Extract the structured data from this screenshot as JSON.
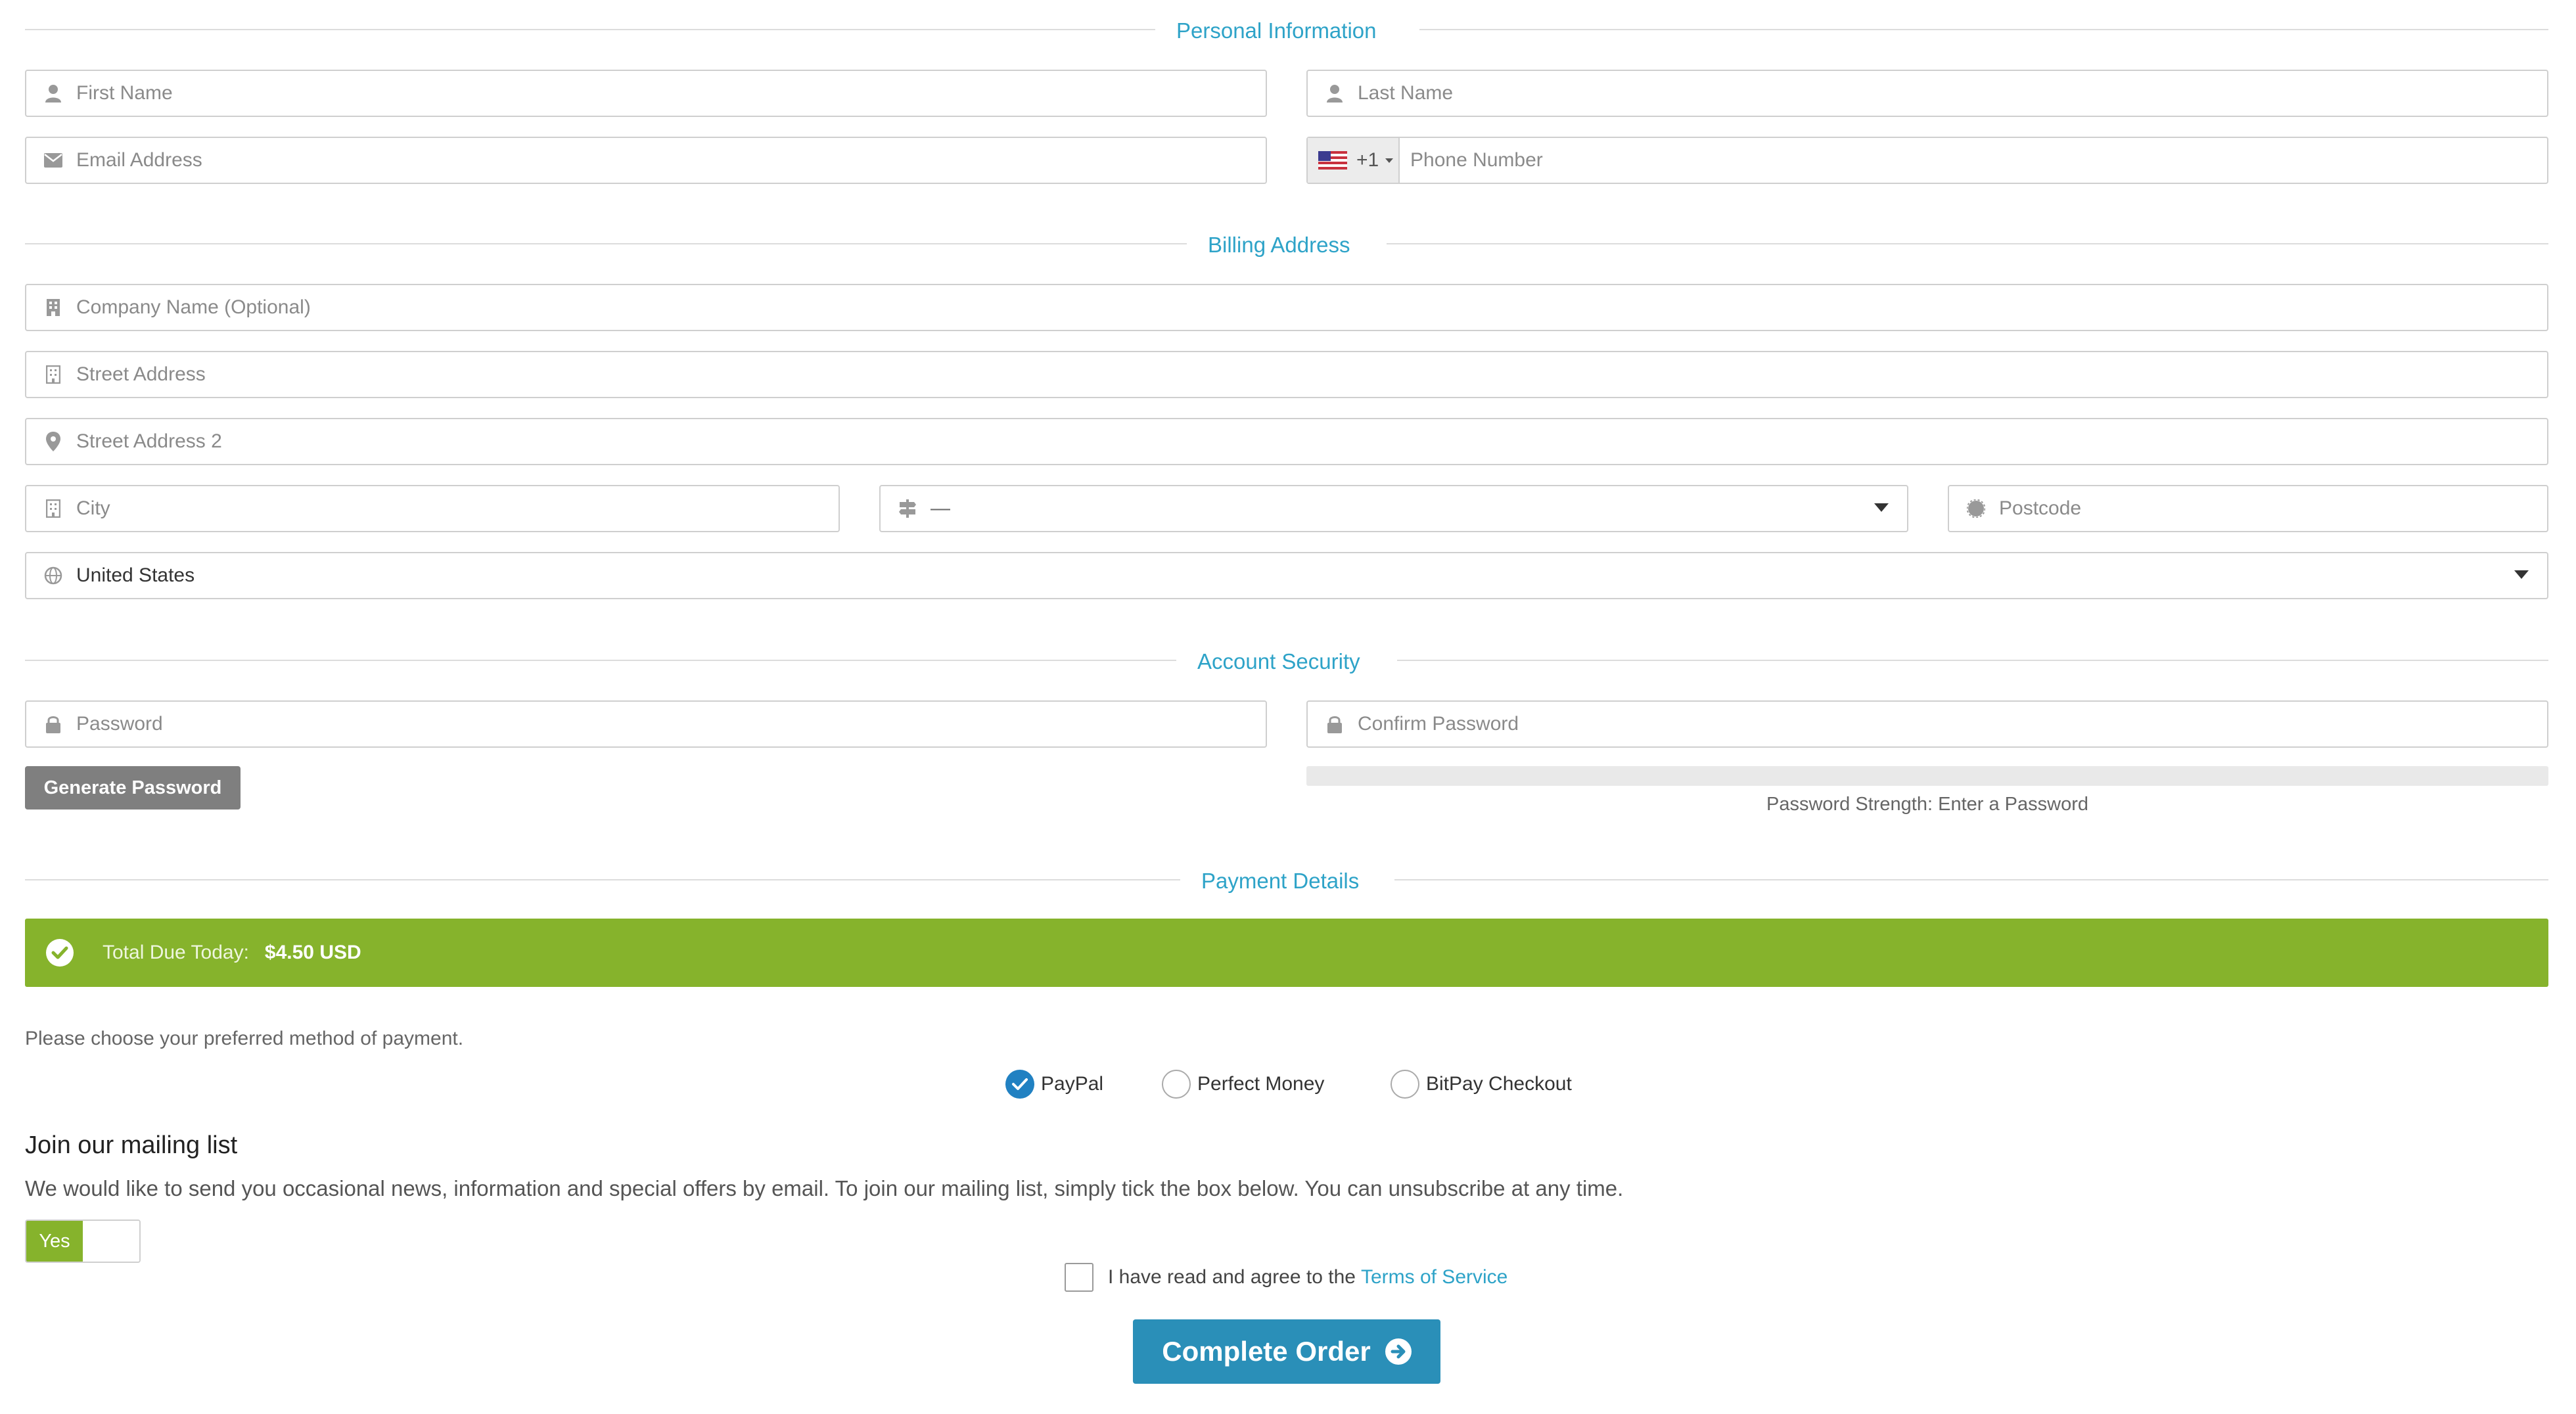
{
  "sections": {
    "personal": "Personal Information",
    "billing": "Billing Address",
    "security": "Account Security",
    "payment": "Payment Details"
  },
  "personal": {
    "first_name_placeholder": "First Name",
    "last_name_placeholder": "Last Name",
    "email_placeholder": "Email Address",
    "phone_country_code": "+1",
    "phone_placeholder": "Phone Number"
  },
  "billing": {
    "company_placeholder": "Company Name (Optional)",
    "street_placeholder": "Street Address",
    "street2_placeholder": "Street Address 2",
    "city_placeholder": "City",
    "state_value": "—",
    "postcode_placeholder": "Postcode",
    "country_value": "United States"
  },
  "security": {
    "password_placeholder": "Password",
    "confirm_placeholder": "Confirm Password",
    "generate_label": "Generate Password",
    "strength_text": "Password Strength: Enter a Password"
  },
  "payment": {
    "total_label": "Total Due Today:",
    "total_amount": "$4.50 USD",
    "prompt": "Please choose your preferred method of payment.",
    "methods": [
      {
        "label": "PayPal",
        "selected": true
      },
      {
        "label": "Perfect Money",
        "selected": false
      },
      {
        "label": "BitPay Checkout",
        "selected": false
      }
    ]
  },
  "mailing": {
    "title": "Join our mailing list",
    "description": "We would like to send you occasional news, information and special offers by email. To join our mailing list, simply tick the box below. You can unsubscribe at any time.",
    "toggle_label": "Yes"
  },
  "terms": {
    "text": "I have read and agree to the",
    "link": "Terms of Service"
  },
  "submit_label": "Complete Order",
  "colors": {
    "accent": "#2ea3c8",
    "success": "#86b32c",
    "primary_button": "#2a8fb8",
    "radio_selected": "#2181c2"
  },
  "icons": [
    "user-icon",
    "envelope-icon",
    "us-flag-icon",
    "building-icon",
    "map-marker-icon",
    "signpost-icon",
    "certificate-icon",
    "globe-icon",
    "lock-icon",
    "check-circle-icon",
    "arrow-circle-right-icon"
  ]
}
